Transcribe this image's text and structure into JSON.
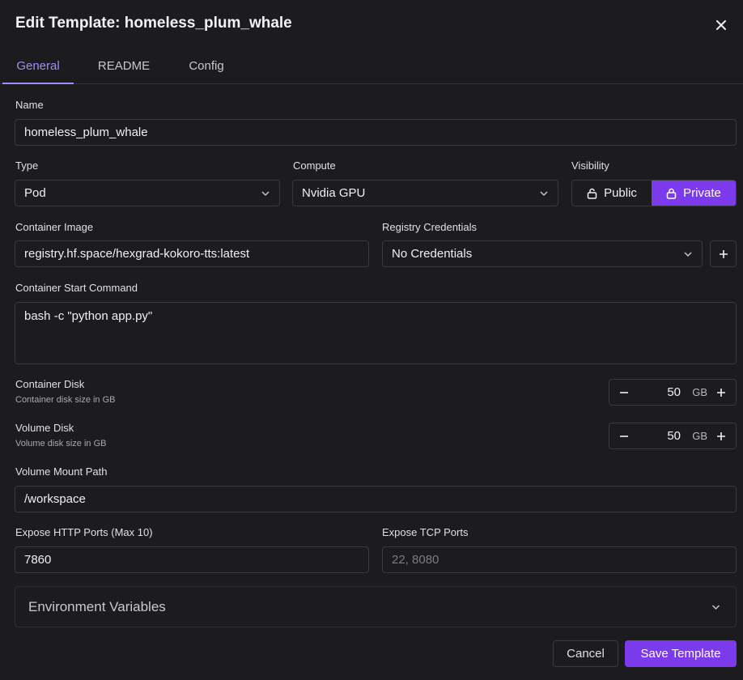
{
  "dialog": {
    "title": "Edit Template: homeless_plum_whale",
    "close_icon": "close-icon"
  },
  "tabs": [
    {
      "label": "General",
      "active": true
    },
    {
      "label": "README",
      "active": false
    },
    {
      "label": "Config",
      "active": false
    }
  ],
  "form": {
    "name": {
      "label": "Name",
      "value": "homeless_plum_whale"
    },
    "type": {
      "label": "Type",
      "value": "Pod"
    },
    "compute": {
      "label": "Compute",
      "value": "Nvidia GPU"
    },
    "visibility": {
      "label": "Visibility",
      "public_label": "Public",
      "private_label": "Private",
      "selected": "Private"
    },
    "container_image": {
      "label": "Container Image",
      "value": "registry.hf.space/hexgrad-kokoro-tts:latest"
    },
    "registry_credentials": {
      "label": "Registry Credentials",
      "value": "No Credentials",
      "add_label": "+"
    },
    "start_command": {
      "label": "Container Start Command",
      "value": "bash -c \"python app.py\""
    },
    "container_disk": {
      "label": "Container Disk",
      "hint": "Container disk size in GB",
      "value": "50",
      "unit": "GB"
    },
    "volume_disk": {
      "label": "Volume Disk",
      "hint": "Volume disk size in GB",
      "value": "50",
      "unit": "GB"
    },
    "volume_mount_path": {
      "label": "Volume Mount Path",
      "value": "/workspace"
    },
    "http_ports": {
      "label": "Expose HTTP Ports (Max 10)",
      "value": "7860"
    },
    "tcp_ports": {
      "label": "Expose TCP Ports",
      "value": "",
      "placeholder": "22, 8080"
    },
    "env_vars": {
      "label": "Environment Variables"
    }
  },
  "footer": {
    "cancel_label": "Cancel",
    "save_label": "Save Template"
  },
  "colors": {
    "accent": "#7c3aed",
    "accent_text": "#a78bfa",
    "background": "#1c1c1e",
    "border": "#3a3a3e"
  }
}
